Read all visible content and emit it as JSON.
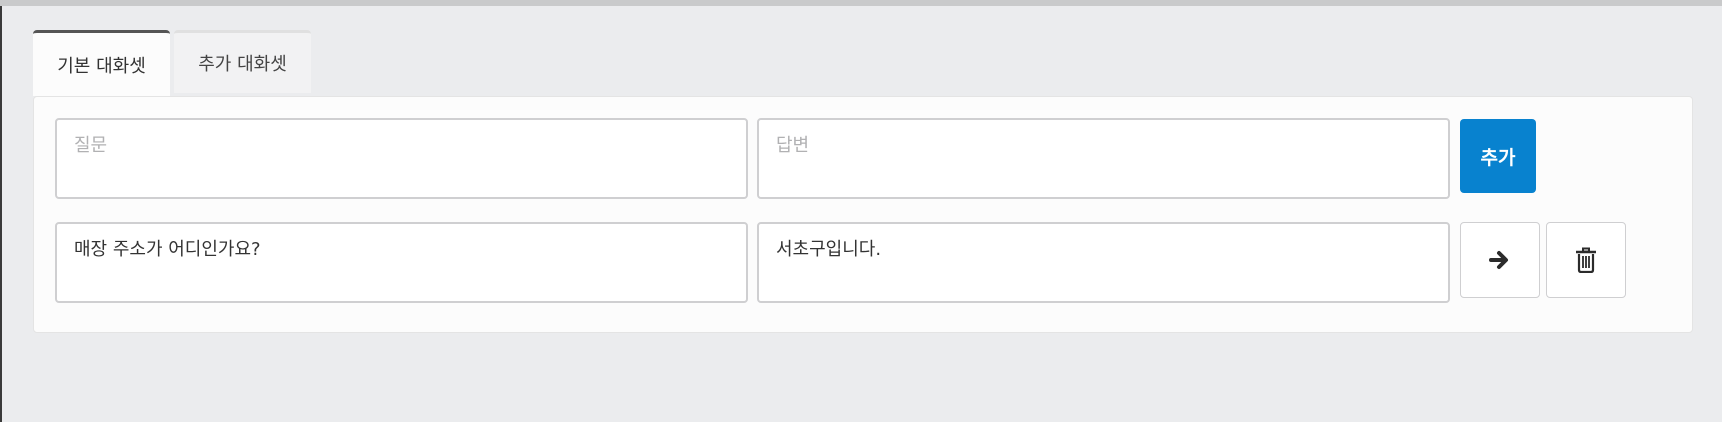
{
  "tabs": [
    {
      "label": "기본 대화셋",
      "active": true
    },
    {
      "label": "추가 대화셋",
      "active": false
    }
  ],
  "new_entry": {
    "question_placeholder": "질문",
    "answer_placeholder": "답변",
    "add_label": "추가"
  },
  "entries": [
    {
      "question": "매장 주소가 어디인가요?",
      "answer": "서초구입니다."
    }
  ],
  "icons": {
    "move": "arrow-right-icon",
    "delete": "trash-icon"
  },
  "colors": {
    "accent": "#0882cf",
    "background": "#ebecee",
    "panel": "#fcfcfc"
  }
}
